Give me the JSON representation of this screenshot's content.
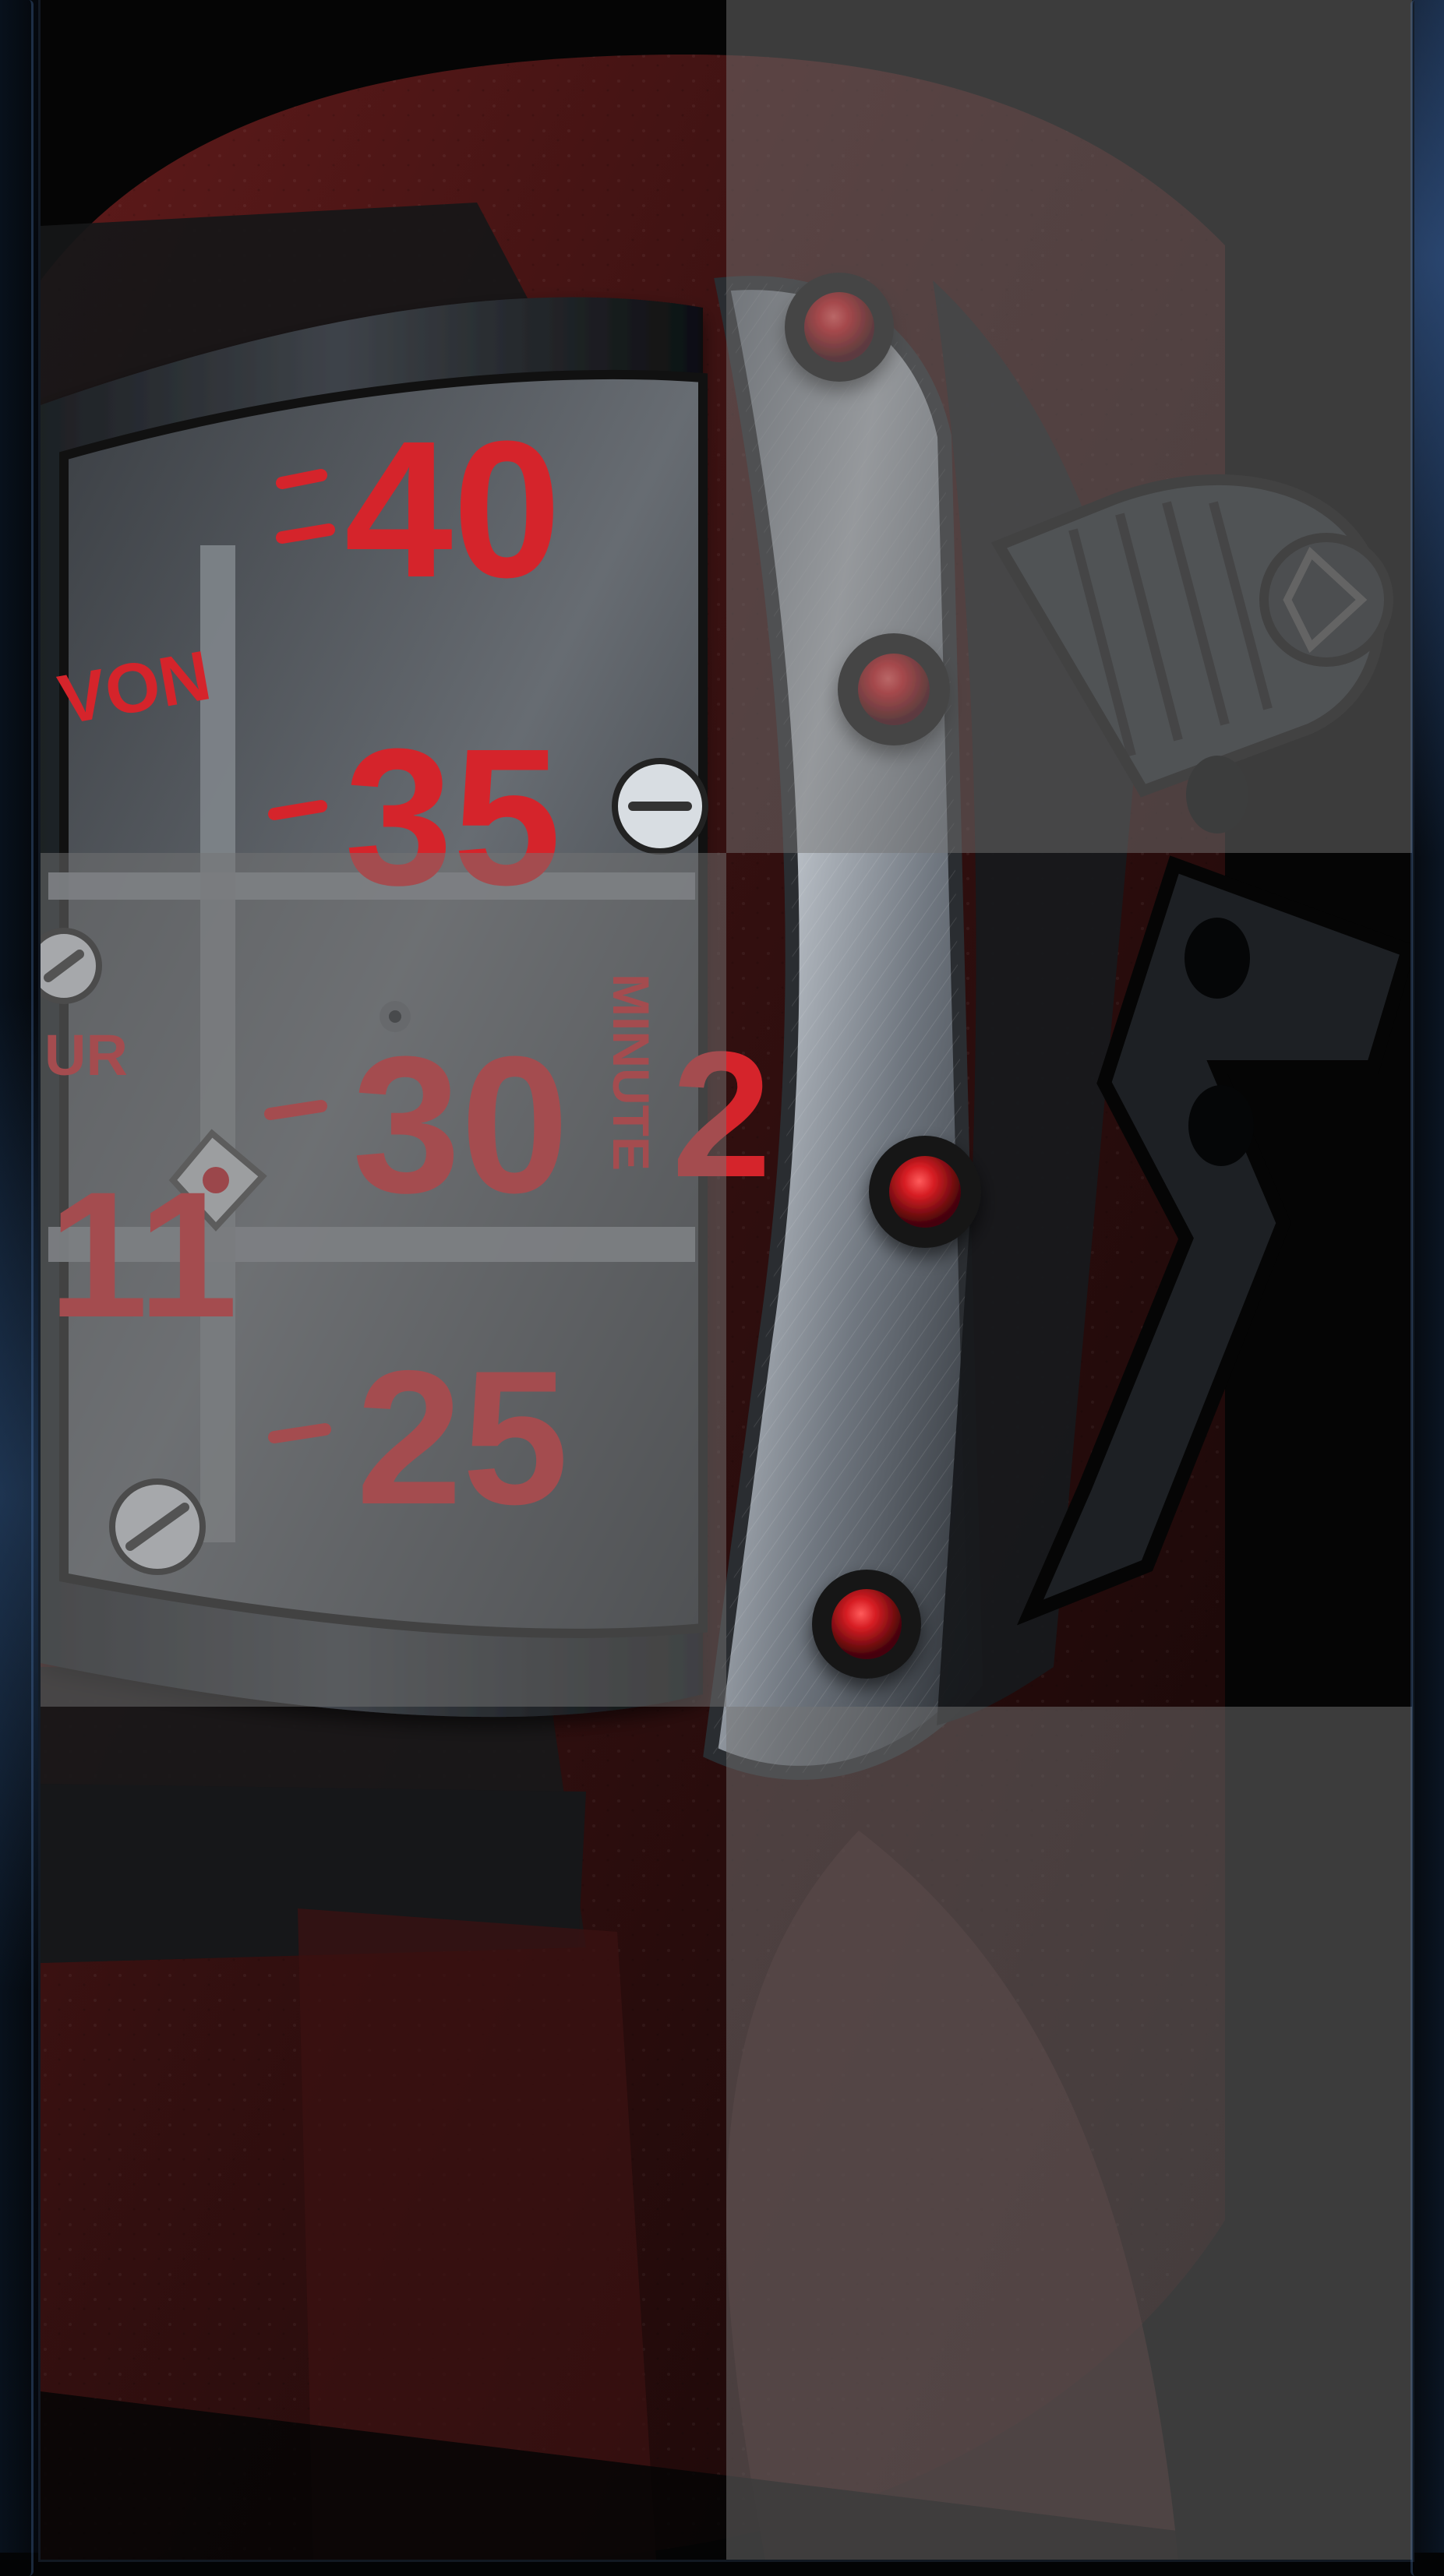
{
  "game": {
    "board_tiles": [
      {
        "state": "revealed"
      },
      {
        "state": "dimmed"
      },
      {
        "state": "dimmed"
      },
      {
        "state": "revealed"
      },
      {
        "state": "revealed"
      },
      {
        "state": "dimmed"
      }
    ]
  },
  "artwork": {
    "dial_words": {
      "brand": "VON",
      "hour": "UR",
      "minute": "MINUTE"
    },
    "minute_numbers": [
      "40",
      "35",
      "30",
      "25"
    ],
    "hour_number": "11",
    "side_digit": "2"
  },
  "colors": {
    "accent_blue": "#4f7fbe",
    "dial_red": "#d5242b",
    "tile_overlay": "#737373",
    "metal": "#a8adb4",
    "strap": "#4a1616"
  }
}
